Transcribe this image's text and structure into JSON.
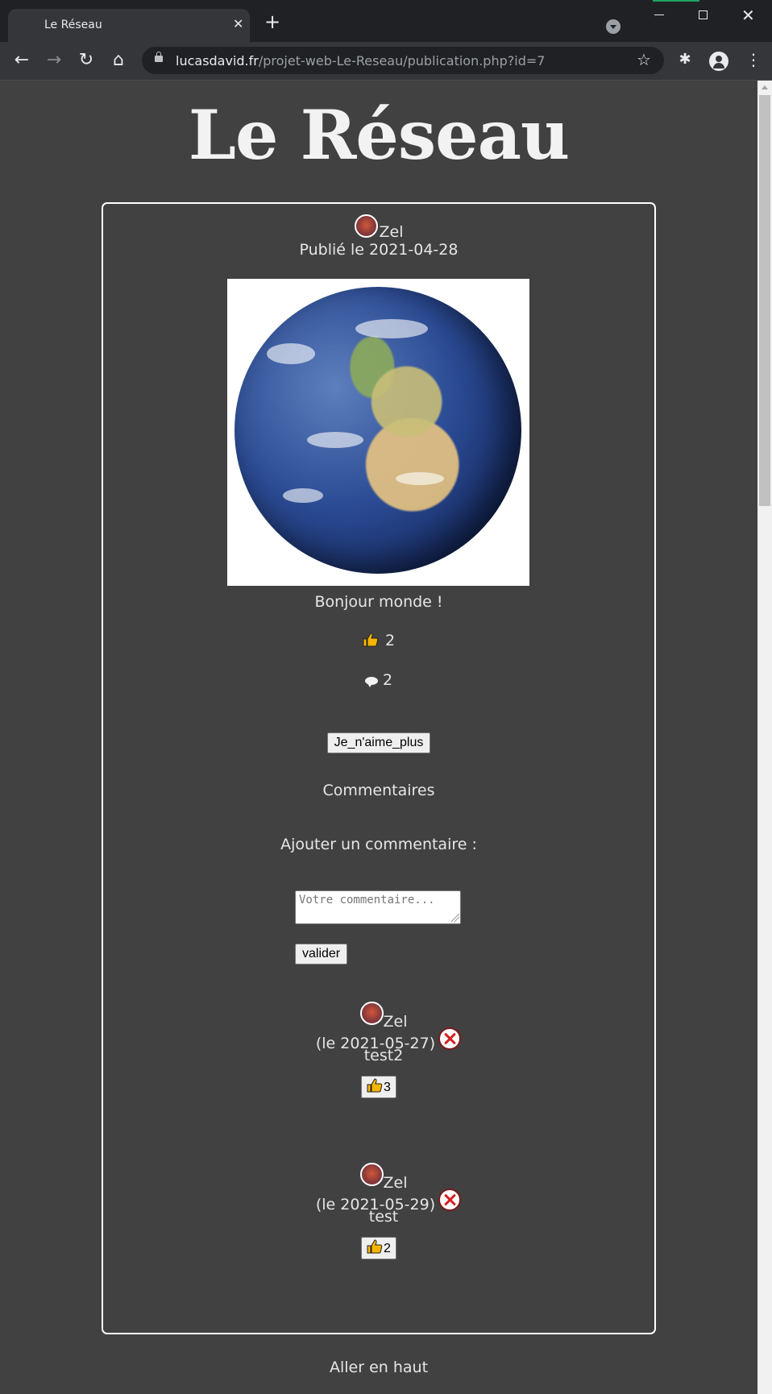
{
  "browser": {
    "tab_title": "Le Réseau",
    "tab_close": "✕",
    "new_tab": "+",
    "url_host": "lucasdavid.fr",
    "url_path": "/projet-web-Le-Reseau/publication.php?id=7",
    "icons": [
      "back-arrow-icon",
      "forward-arrow-icon",
      "reload-icon",
      "home-icon",
      "lock-icon",
      "star-icon",
      "extensions-icon",
      "profile-icon",
      "menu-icon"
    ]
  },
  "site": {
    "title": "Le Réseau"
  },
  "post": {
    "author": "Zel",
    "published": "Publié le 2021-04-28",
    "caption": "Bonjour monde !",
    "likes": "2",
    "comments": "2",
    "unlike_label": "Je_n'aime_plus"
  },
  "comments_section": {
    "heading": "Commentaires",
    "add_heading": "Ajouter un commentaire :",
    "placeholder": "Votre commentaire...",
    "submit_label": "valider",
    "items": [
      {
        "author": "Zel",
        "date": "(le 2021-05-27)",
        "text": "test2",
        "likes": "3"
      },
      {
        "author": "Zel",
        "date": "(le 2021-05-29)",
        "text": "test",
        "likes": "2"
      }
    ]
  },
  "footer": {
    "top_link": "Aller en haut"
  },
  "colors": {
    "page_bg": "#414141",
    "card_border": "#ffffff",
    "text": "#e6e6e6",
    "delete": "#d61f1f"
  }
}
